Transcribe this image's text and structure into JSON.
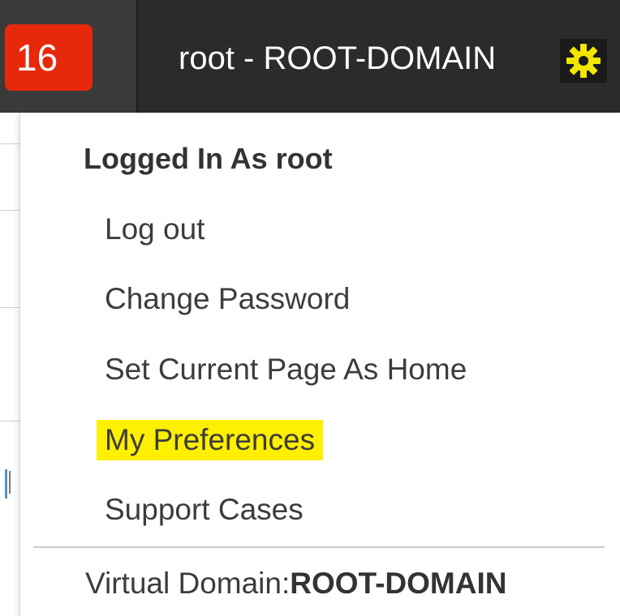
{
  "header": {
    "notification_count": "16",
    "user_label": "root - ROOT-DOMAIN",
    "settings_icon": "gear-icon",
    "accent_color": "#ffef00",
    "badge_color": "#e8280b"
  },
  "menu": {
    "heading": "Logged In As root",
    "items": [
      {
        "label": "Log out"
      },
      {
        "label": "Change Password"
      },
      {
        "label": "Set Current Page As Home"
      },
      {
        "label": "My Preferences",
        "highlighted": true
      },
      {
        "label": "Support Cases"
      }
    ],
    "virtual_domain_label": "Virtual Domain:",
    "virtual_domain_value": "ROOT-DOMAIN"
  }
}
